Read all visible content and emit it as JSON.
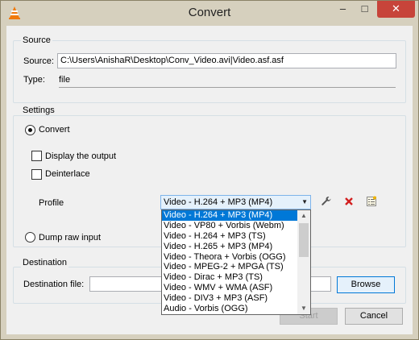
{
  "window": {
    "title": "Convert",
    "minimize_glyph": "–",
    "maximize_glyph": "□",
    "close_glyph": "✕",
    "app_icon": "vlc-cone-icon"
  },
  "source": {
    "group_label": "Source",
    "source_label": "Source:",
    "source_value": "C:\\Users\\AnishaR\\Desktop\\Conv_Video.avi|Video.asf.asf",
    "type_label": "Type:",
    "type_value": "file"
  },
  "settings": {
    "group_label": "Settings",
    "convert_label": "Convert",
    "convert_selected": true,
    "display_output_label": "Display the output",
    "display_output_checked": false,
    "deinterlace_label": "Deinterlace",
    "deinterlace_checked": false,
    "profile_label": "Profile",
    "profile_selected": "Video - H.264 + MP3 (MP4)",
    "profile_options": [
      "Video - H.264 + MP3 (MP4)",
      "Video - VP80 + Vorbis (Webm)",
      "Video - H.264 + MP3 (TS)",
      "Video - H.265 + MP3 (MP4)",
      "Video - Theora + Vorbis (OGG)",
      "Video - MPEG-2 + MPGA (TS)",
      "Video - Dirac + MP3 (TS)",
      "Video - WMV + WMA (ASF)",
      "Video - DIV3 + MP3 (ASF)",
      "Audio - Vorbis (OGG)"
    ],
    "edit_profile_icon": "wrench-icon",
    "delete_profile_icon": "red-x-icon",
    "new_profile_icon": "new-profile-icon",
    "dump_raw_label": "Dump raw input",
    "dump_raw_selected": false
  },
  "destination": {
    "group_label": "Destination",
    "file_label": "Destination file:",
    "file_value": "",
    "browse_label": "Browse"
  },
  "actions": {
    "start_label": "Start",
    "cancel_label": "Cancel"
  },
  "colors": {
    "selection": "#0078d7",
    "frame": "#d6d0be",
    "close": "#c7443a"
  }
}
